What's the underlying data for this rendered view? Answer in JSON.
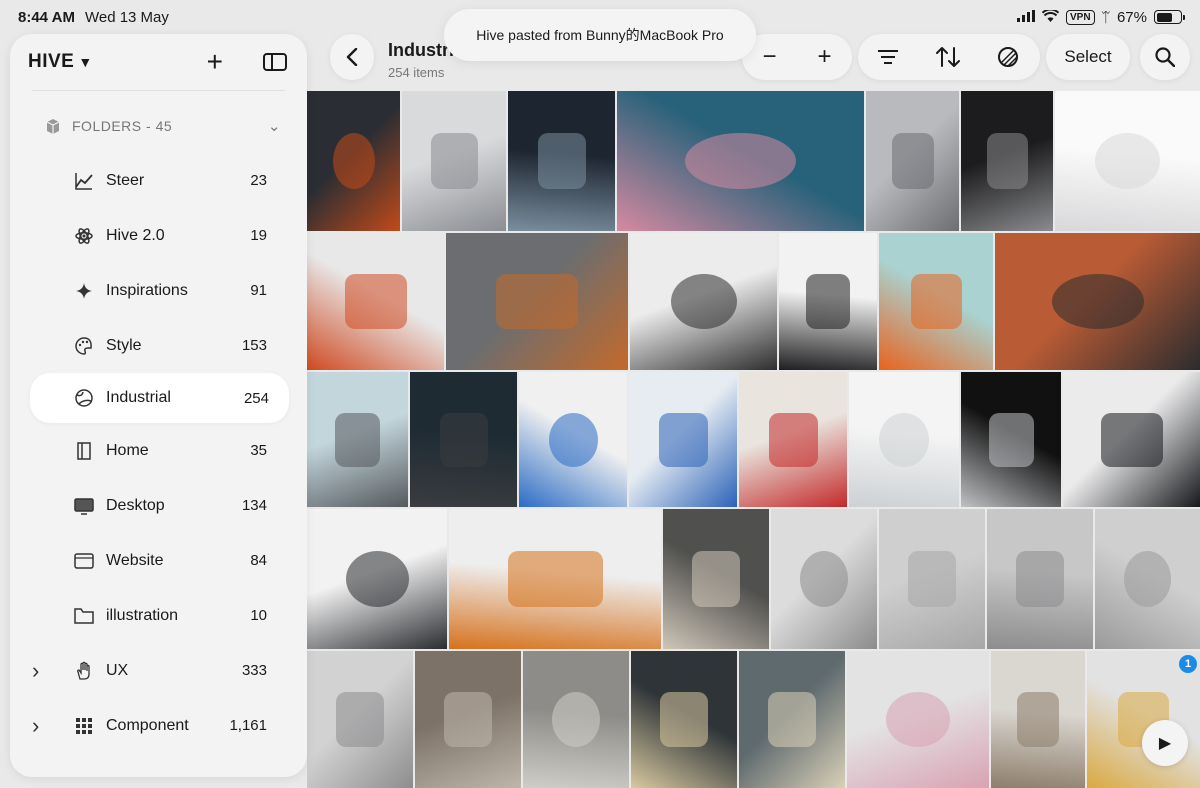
{
  "status": {
    "time": "8:44 AM",
    "date": "Wed 13 May",
    "vpn": "VPN",
    "battery": "67%",
    "battery_level": 0.67
  },
  "toast": "Hive pasted from Bunny的MacBook Pro",
  "sidebar": {
    "title": "HIVE",
    "folders_header": "FOLDERS - 45",
    "items": [
      {
        "label": "Steer",
        "count": "23",
        "icon": "chart-icon"
      },
      {
        "label": "Hive 2.0",
        "count": "19",
        "icon": "atom-icon"
      },
      {
        "label": "Inspirations",
        "count": "91",
        "icon": "sparkle-icon"
      },
      {
        "label": "Style",
        "count": "153",
        "icon": "palette-icon"
      },
      {
        "label": "Industrial",
        "count": "254",
        "icon": "globe-icon"
      },
      {
        "label": "Home",
        "count": "35",
        "icon": "door-icon"
      },
      {
        "label": "Desktop",
        "count": "134",
        "icon": "monitor-icon"
      },
      {
        "label": "Website",
        "count": "84",
        "icon": "browser-icon"
      },
      {
        "label": "illustration",
        "count": "10",
        "icon": "folder-icon"
      },
      {
        "label": "UX",
        "count": "333",
        "icon": "hand-icon"
      },
      {
        "label": "Component",
        "count": "1,161",
        "icon": "grid-icon"
      }
    ]
  },
  "header": {
    "title": "Industrial",
    "subtitle": "254 items",
    "select_label": "Select"
  },
  "badge": "1",
  "colors": {
    "accent": "#1a8ce8",
    "panel": "#f3f3f4",
    "background": "#e9e9ea"
  }
}
